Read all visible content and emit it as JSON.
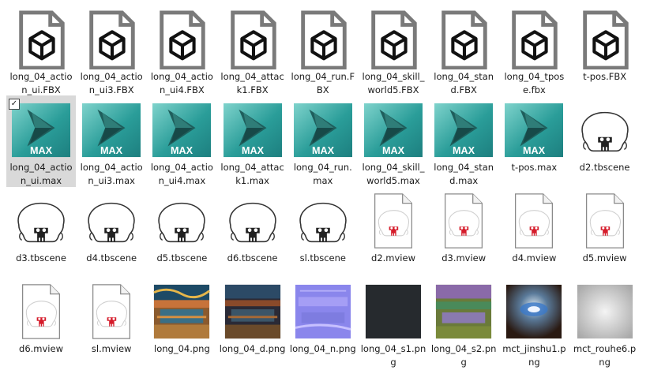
{
  "files": [
    {
      "name": "long_04_action_ui.FBX",
      "kind": "fbx"
    },
    {
      "name": "long_04_action_ui3.FBX",
      "kind": "fbx"
    },
    {
      "name": "long_04_action_ui4.FBX",
      "kind": "fbx"
    },
    {
      "name": "long_04_attack1.FBX",
      "kind": "fbx"
    },
    {
      "name": "long_04_run.FBX",
      "kind": "fbx"
    },
    {
      "name": "long_04_skill_world5.FBX",
      "kind": "fbx"
    },
    {
      "name": "long_04_stand.FBX",
      "kind": "fbx"
    },
    {
      "name": "long_04_tpose.fbx",
      "kind": "fbx"
    },
    {
      "name": "t-pos.FBX",
      "kind": "fbx"
    },
    {
      "name": "long_04_action_ui.max",
      "kind": "max",
      "selected": true,
      "checked": true
    },
    {
      "name": "long_04_action_ui3.max",
      "kind": "max"
    },
    {
      "name": "long_04_action_ui4.max",
      "kind": "max"
    },
    {
      "name": "long_04_attack1.max",
      "kind": "max"
    },
    {
      "name": "long_04_run.max",
      "kind": "max"
    },
    {
      "name": "long_04_skill_world5.max",
      "kind": "max"
    },
    {
      "name": "long_04_stand.max",
      "kind": "max"
    },
    {
      "name": "t-pos.max",
      "kind": "max"
    },
    {
      "name": "d2.tbscene",
      "kind": "tbscene"
    },
    {
      "name": "d3.tbscene",
      "kind": "tbscene"
    },
    {
      "name": "d4.tbscene",
      "kind": "tbscene"
    },
    {
      "name": "d5.tbscene",
      "kind": "tbscene"
    },
    {
      "name": "d6.tbscene",
      "kind": "tbscene"
    },
    {
      "name": "sl.tbscene",
      "kind": "tbscene"
    },
    {
      "name": "d2.mview",
      "kind": "mview"
    },
    {
      "name": "d3.mview",
      "kind": "mview"
    },
    {
      "name": "d4.mview",
      "kind": "mview"
    },
    {
      "name": "d5.mview",
      "kind": "mview"
    },
    {
      "name": "d6.mview",
      "kind": "mview"
    },
    {
      "name": "sl.mview",
      "kind": "mview"
    },
    {
      "name": "long_04.png",
      "kind": "png-albedo"
    },
    {
      "name": "long_04_d.png",
      "kind": "png-dark"
    },
    {
      "name": "long_04_n.png",
      "kind": "png-normal"
    },
    {
      "name": "long_04_s1.png",
      "kind": "png-black"
    },
    {
      "name": "long_04_s2.png",
      "kind": "png-spec"
    },
    {
      "name": "mct_jinshu1.png",
      "kind": "png-sphere"
    },
    {
      "name": "mct_rouhe6.png",
      "kind": "png-soft"
    }
  ],
  "icons": {
    "fbx": "fbx-file-icon",
    "max": "3dsmax-file-icon",
    "tbscene": "toolbag-scene-icon",
    "mview": "marmoset-viewer-icon",
    "png-albedo": "image-thumbnail",
    "png-dark": "image-thumbnail",
    "png-normal": "image-thumbnail",
    "png-black": "image-thumbnail",
    "png-spec": "image-thumbnail",
    "png-sphere": "image-thumbnail",
    "png-soft": "image-thumbnail"
  },
  "max_badge": "MAX",
  "colors": {
    "selection": "#d9d9d9",
    "max_teal": "#2a9d99",
    "mview_red": "#d51c2b"
  }
}
